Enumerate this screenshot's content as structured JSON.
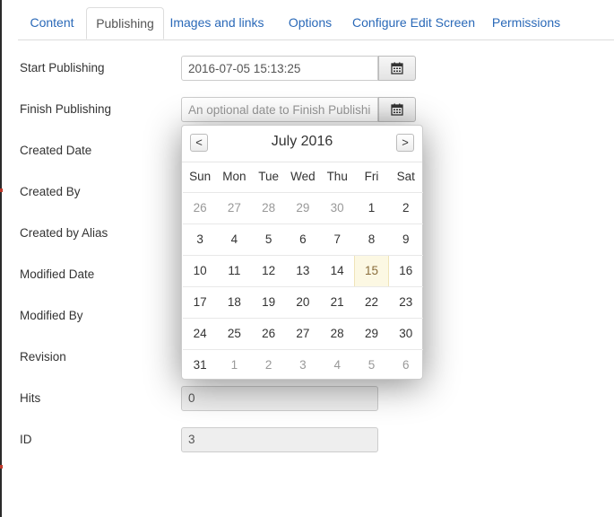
{
  "tabs": [
    {
      "label": "Content"
    },
    {
      "label": "Publishing"
    },
    {
      "label": "Images and links"
    },
    {
      "label": "Options"
    },
    {
      "label": "Configure Edit Screen"
    },
    {
      "label": "Permissions"
    }
  ],
  "active_tab": "Publishing",
  "fields": {
    "start_publishing": {
      "label": "Start Publishing",
      "value": "2016-07-05 15:13:25"
    },
    "finish_publishing": {
      "label": "Finish Publishing",
      "placeholder": "An optional date to Finish Publishing"
    },
    "created_date": {
      "label": "Created Date"
    },
    "created_by": {
      "label": "Created By"
    },
    "created_by_alias": {
      "label": "Created by Alias"
    },
    "modified_date": {
      "label": "Modified Date"
    },
    "modified_by": {
      "label": "Modified By"
    },
    "revision": {
      "label": "Revision"
    },
    "hits": {
      "label": "Hits",
      "value": "0"
    },
    "id": {
      "label": "ID",
      "value": "3"
    }
  },
  "calendar": {
    "title": "July 2016",
    "prev_label": "<",
    "next_label": ">",
    "weekdays": [
      "Sun",
      "Mon",
      "Tue",
      "Wed",
      "Thu",
      "Fri",
      "Sat"
    ],
    "today": "15",
    "weeks": [
      [
        {
          "d": "26",
          "other": true
        },
        {
          "d": "27",
          "other": true
        },
        {
          "d": "28",
          "other": true
        },
        {
          "d": "29",
          "other": true
        },
        {
          "d": "30",
          "other": true
        },
        {
          "d": "1"
        },
        {
          "d": "2"
        }
      ],
      [
        {
          "d": "3"
        },
        {
          "d": "4"
        },
        {
          "d": "5"
        },
        {
          "d": "6"
        },
        {
          "d": "7"
        },
        {
          "d": "8"
        },
        {
          "d": "9"
        }
      ],
      [
        {
          "d": "10"
        },
        {
          "d": "11"
        },
        {
          "d": "12"
        },
        {
          "d": "13"
        },
        {
          "d": "14"
        },
        {
          "d": "15",
          "today": true
        },
        {
          "d": "16"
        }
      ],
      [
        {
          "d": "17"
        },
        {
          "d": "18"
        },
        {
          "d": "19"
        },
        {
          "d": "20"
        },
        {
          "d": "21"
        },
        {
          "d": "22"
        },
        {
          "d": "23"
        }
      ],
      [
        {
          "d": "24"
        },
        {
          "d": "25"
        },
        {
          "d": "26"
        },
        {
          "d": "27"
        },
        {
          "d": "28"
        },
        {
          "d": "29"
        },
        {
          "d": "30"
        }
      ],
      [
        {
          "d": "31"
        },
        {
          "d": "1",
          "other": true
        },
        {
          "d": "2",
          "other": true
        },
        {
          "d": "3",
          "other": true
        },
        {
          "d": "4",
          "other": true
        },
        {
          "d": "5",
          "other": true
        },
        {
          "d": "6",
          "other": true
        }
      ]
    ]
  },
  "colors": {
    "link": "#2a69b8",
    "today_bg": "#fcf8e3"
  },
  "icons": {
    "calendar_button": "calendar-icon"
  }
}
